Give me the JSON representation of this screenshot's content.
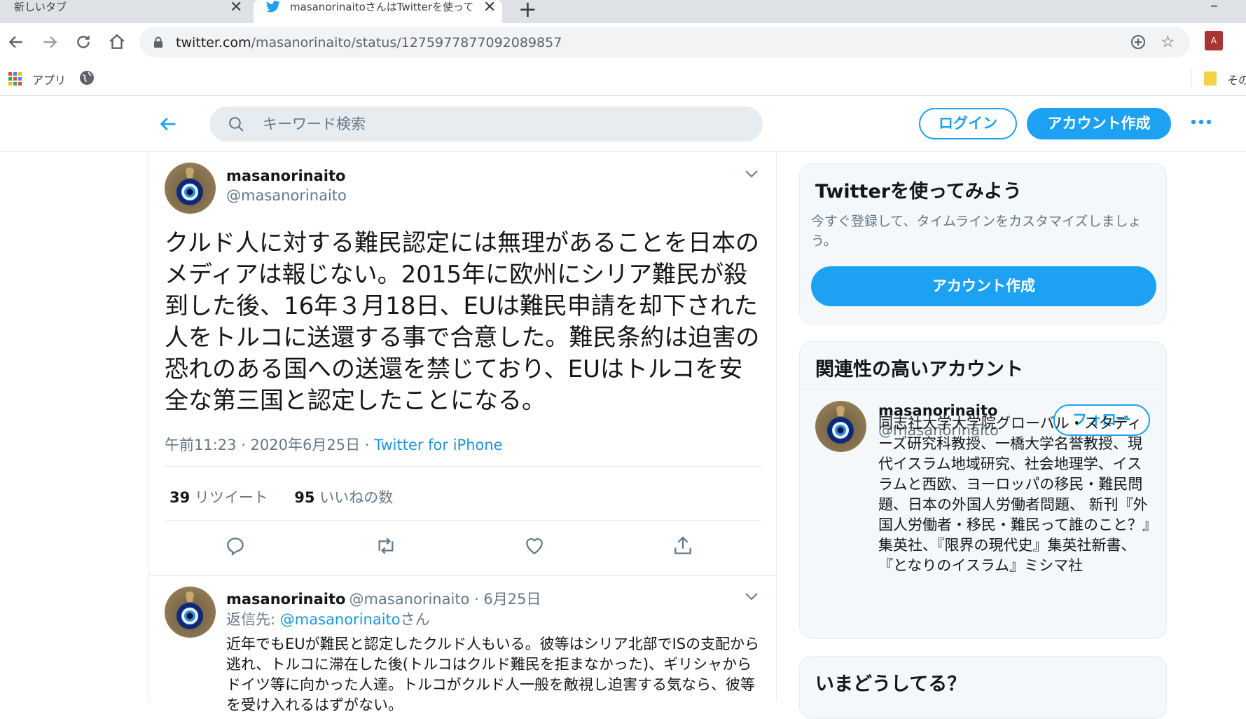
{
  "browser": {
    "tabs": [
      {
        "title": "新しいタブ"
      },
      {
        "title": "masanorinaitoさんはTwitterを使って"
      }
    ],
    "url_host": "twitter.com",
    "url_path": "/masanorinaito/status/1275977877092089857",
    "bookmarks": {
      "apps_label": "アプリ",
      "other_label": "その"
    }
  },
  "header": {
    "search_placeholder": "キーワード検索",
    "login_label": "ログイン",
    "signup_label": "アカウント作成"
  },
  "tweet": {
    "name": "masanorinaito",
    "handle": "@masanorinaito",
    "text": "クルド人に対する難民認定には無理があることを日本のメディアは報じない。2015年に欧州にシリア難民が殺到した後、16年３月18日、EUは難民申請を却下された人をトルコに送還する事で合意した。難民条約は迫害の恐れのある国への送還を禁じており、EUはトルコを安全な第三国と認定したことになる。",
    "timestamp": "午前11:23 · 2020年6月25日 · ",
    "source": "Twitter for iPhone",
    "retweet_count": "39",
    "retweet_label": "リツイート",
    "like_count": "95",
    "like_label": "いいねの数"
  },
  "reply": {
    "name": "masanorinaito",
    "handle_date": "@masanorinaito · 6月25日",
    "reply_to_prefix": "返信先: ",
    "reply_to_handle": "@masanorinaito",
    "reply_to_suffix": "さん",
    "text": "近年でもEUが難民と認定したクルド人もいる。彼等はシリア北部でISの支配から逃れ、トルコに滞在した後(トルコはクルド難民を拒まなかった)、ギリシャからドイツ等に向かった人達。トルコがクルド人一般を敵視し迫害する気なら、彼等を受け入れるはずがない。"
  },
  "sidebar": {
    "signup_card": {
      "title": "Twitterを使ってみよう",
      "desc": "今すぐ登録して、タイムラインをカスタマイズしましょう。",
      "button": "アカウント作成"
    },
    "related_card": {
      "title": "関連性の高いアカウント",
      "name": "masanorinaito",
      "handle": "@masanorinaito",
      "follow_label": "フォロー",
      "bio": "同志社大学大学院グローバル・スタディーズ研究科教授、一橋大学名誉教授、現代イスラム地域研究、社会地理学、イスラムと西欧、ヨーロッパの移民・難民問題、日本の外国人労働者問題、 新刊『外国人労働者・移民・難民って誰のこと？』集英社、『限界の現代史』集英社新書、『となりのイスラム』ミシマ社"
    },
    "whats_happening": {
      "title": "いまどうしてる？"
    }
  },
  "colors": {
    "accent": "#1da1f2",
    "text": "#14171a",
    "muted": "#657786",
    "border": "#e6ecf0"
  }
}
